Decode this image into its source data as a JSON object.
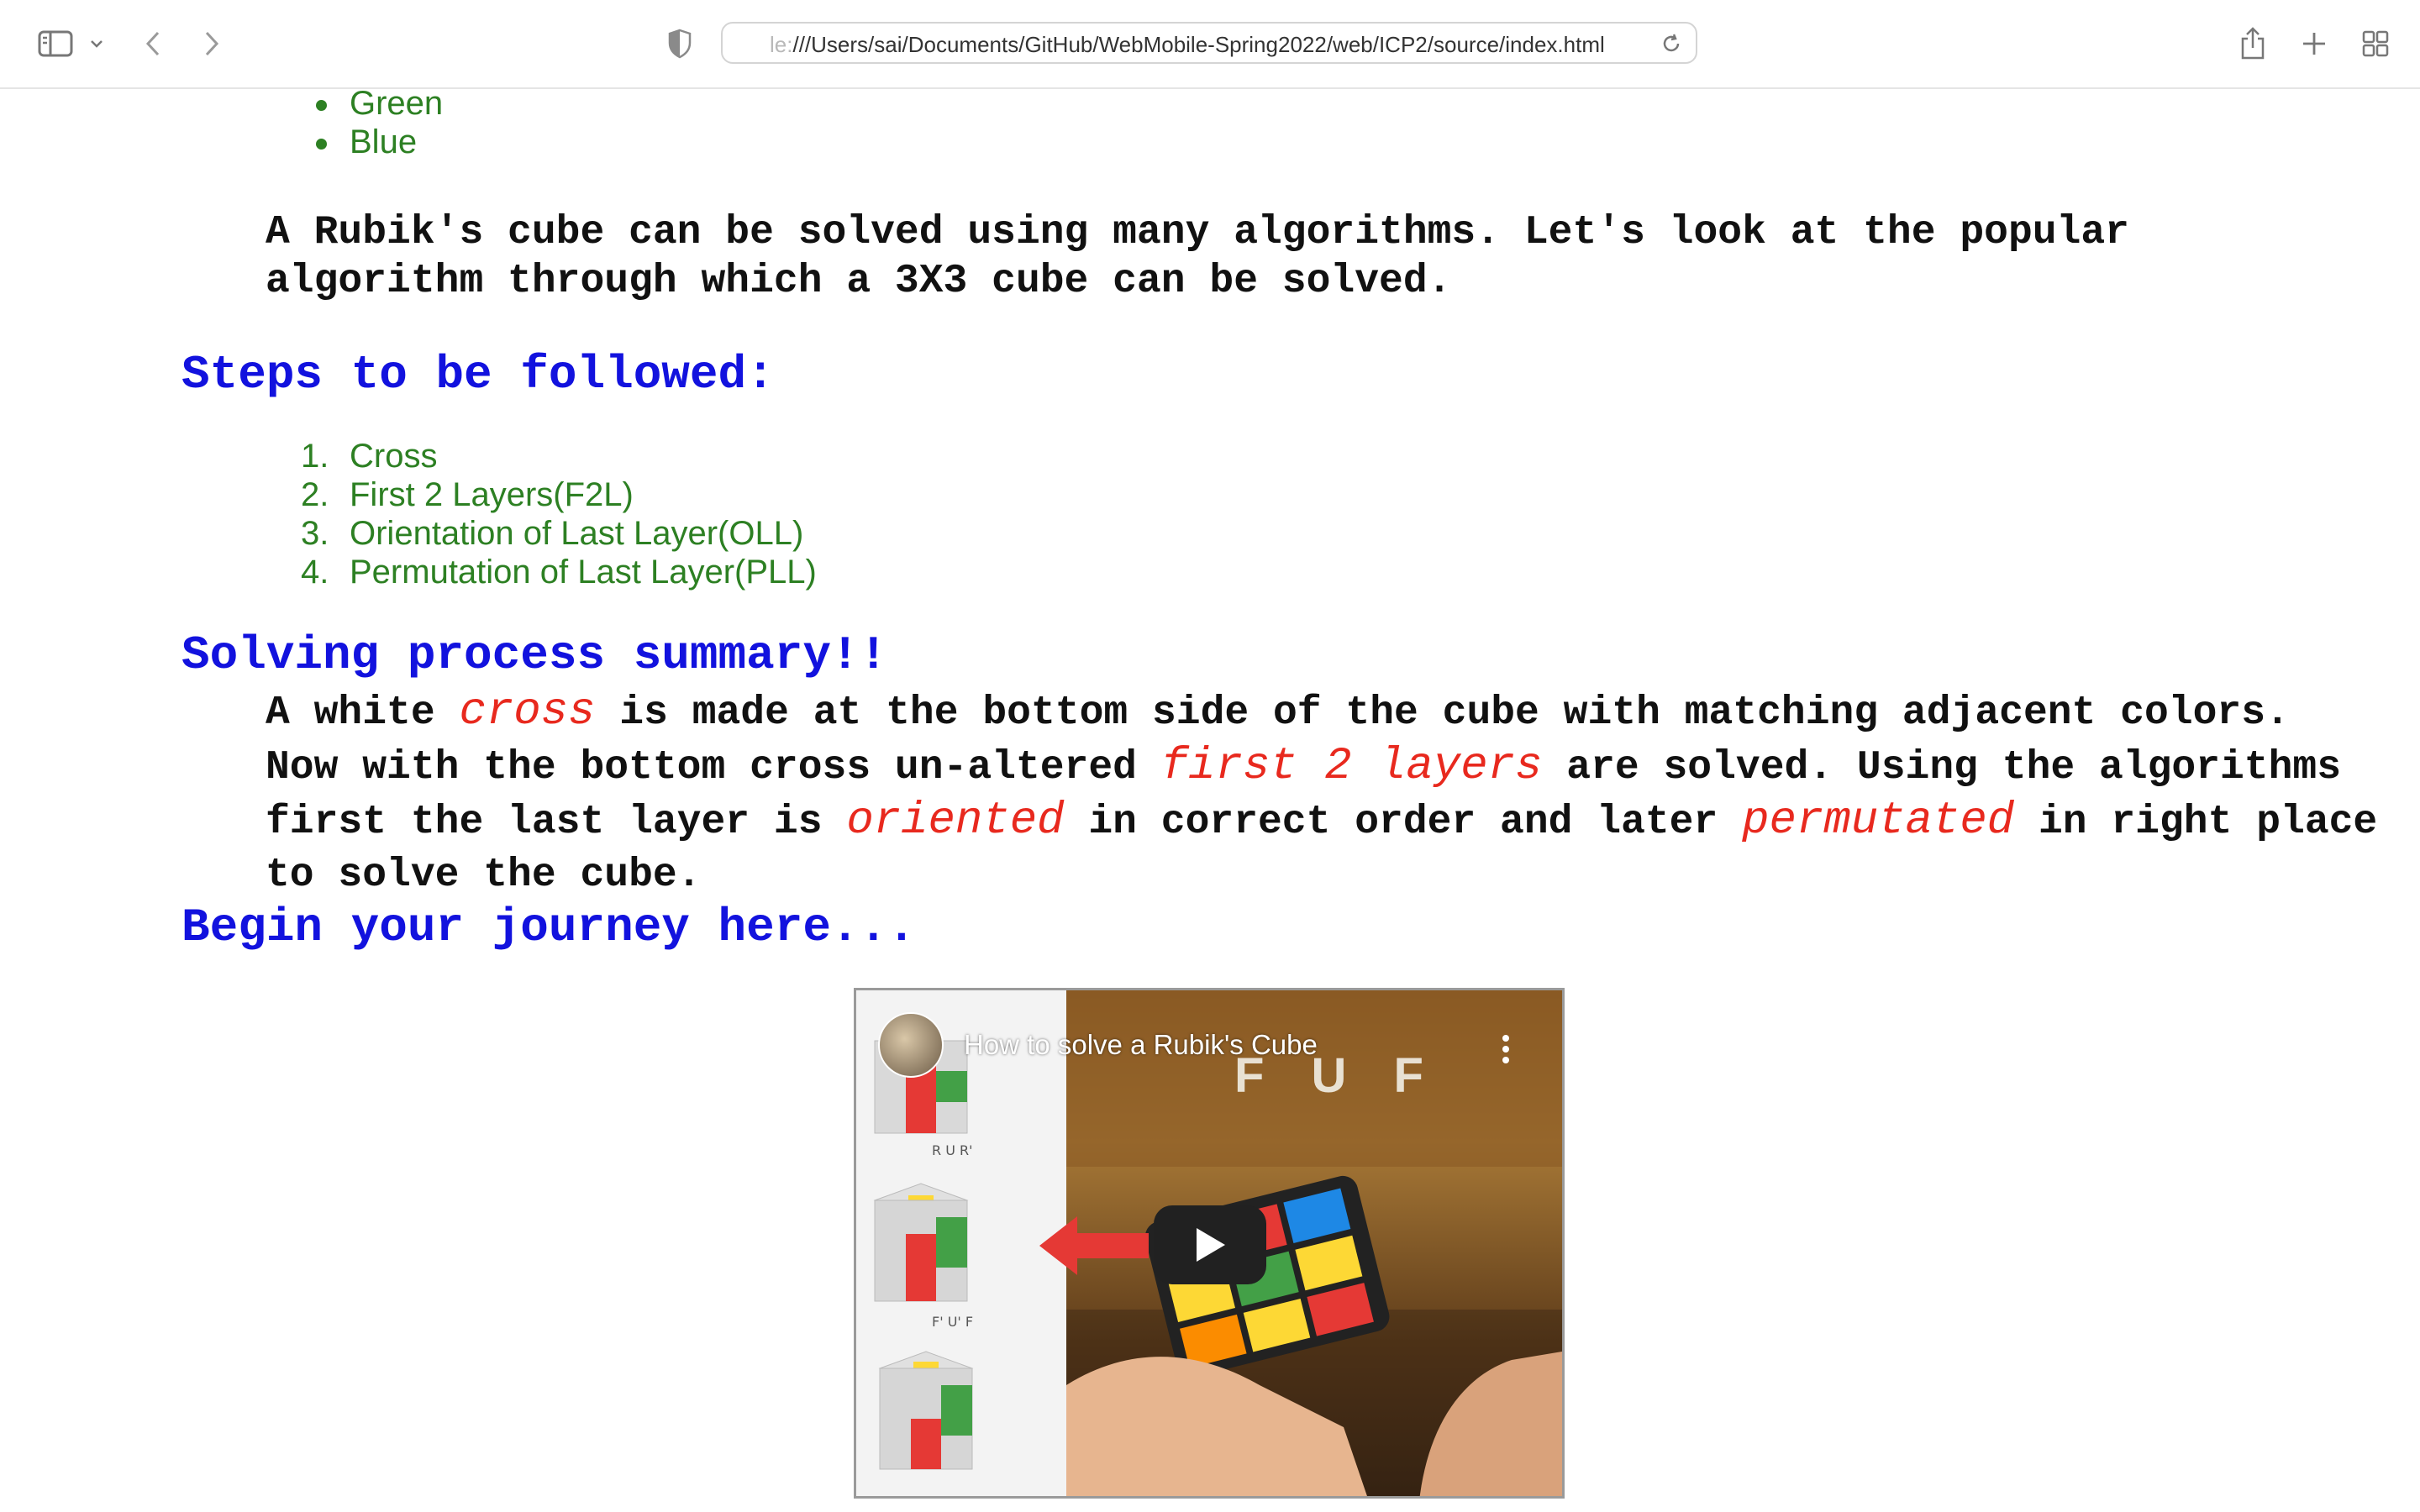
{
  "browser": {
    "url_dim": "le:",
    "url": "///Users/sai/Documents/GitHub/WebMobile-Spring2022/web/ICP2/source/index.html"
  },
  "page": {
    "bullets": [
      "Green",
      "Blue"
    ],
    "intro_line1": "A Rubik's cube can be solved using many algorithms. Let's look at the popular",
    "intro_line2": "algorithm through which a 3X3 cube can be solved.",
    "steps_heading": "Steps to be followed:",
    "steps": [
      {
        "num": "1.",
        "label": "Cross"
      },
      {
        "num": "2.",
        "label": "First 2 Layers(F2L)"
      },
      {
        "num": "3.",
        "label": "Orientation of Last Layer(OLL)"
      },
      {
        "num": "4.",
        "label": "Permutation of Last Layer(PLL)"
      }
    ],
    "summary_heading": "Solving process summary!!",
    "summary": {
      "t1": "A white ",
      "e1": "cross",
      "t2": " is made at the bottom side of the cube with matching adjacent colors. Now with the bottom cross un-altered ",
      "e2": "first 2 layers",
      "t3": " are solved. Using the algorithms first the last layer is ",
      "e3": "oriented",
      "t4": " in correct order and later ",
      "e4": "permutated",
      "t5": " in right place to solve the cube."
    },
    "journey_heading": "Begin your journey here...",
    "video": {
      "title": "How to solve a Rubik's Cube",
      "overlay_text": "F U F"
    }
  },
  "colors": {
    "heading_blue": "#1212de",
    "list_green": "#2d8023",
    "emphasis_red": "#e8291e"
  }
}
